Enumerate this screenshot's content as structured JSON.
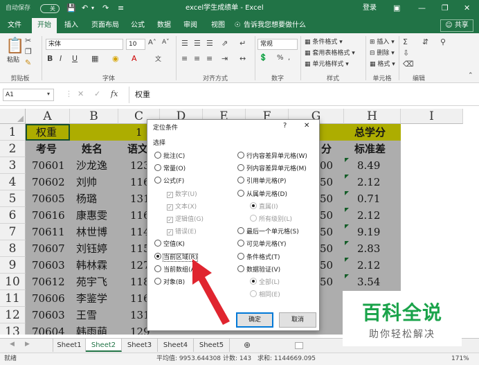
{
  "title_bar": {
    "autosave": "自动保存",
    "autosave_state": "关",
    "title": "excel学生成绩单 - Excel",
    "login": "登录"
  },
  "tabs": [
    "文件",
    "开始",
    "插入",
    "页面布局",
    "公式",
    "数据",
    "审阅",
    "视图",
    "告诉我您想要做什么",
    "共享"
  ],
  "ribbon": {
    "paste": "粘贴",
    "clipboard": "剪贴板",
    "font_name": "宋体",
    "font_size": "10",
    "font_group": "字体",
    "align_group": "对齐方式",
    "number_format": "常规",
    "number_group": "数字",
    "cond_format": "条件格式",
    "table_format": "套用表格格式",
    "cell_style": "单元格样式",
    "style_group": "样式",
    "insert": "插入",
    "delete": "删除",
    "format": "格式",
    "cells_group": "单元格",
    "edit_group": "编辑"
  },
  "formula_bar": {
    "name_box": "A1",
    "fx": "fx",
    "value": "权重"
  },
  "columns": [
    "A",
    "B",
    "C",
    "D",
    "E",
    "F",
    "G",
    "H",
    "I"
  ],
  "rows": [
    "1",
    "2",
    "3",
    "4",
    "5",
    "6",
    "7",
    "8",
    "9",
    "10",
    "11",
    "12",
    "13"
  ],
  "cells": {
    "a1": "权重",
    "c1": "1",
    "h1": "总学分",
    "a2": "考号",
    "b2": "姓名",
    "c2": "语文",
    "g2": "分",
    "h2": "标准差",
    "data": [
      {
        "id": "70601",
        "name": "沙龙逸",
        "c": "123",
        "g": "00",
        "h": "8.49"
      },
      {
        "id": "70602",
        "name": "刘帅",
        "c": "116",
        "g": "50",
        "h": "2.12"
      },
      {
        "id": "70605",
        "name": "杨璐",
        "c": "131",
        "g": "50",
        "h": "0.71"
      },
      {
        "id": "70616",
        "name": "康惠雯",
        "c": "116",
        "g": "50",
        "h": "2.12"
      },
      {
        "id": "70611",
        "name": "林世博",
        "c": "114",
        "g": "50",
        "h": "9.19"
      },
      {
        "id": "70607",
        "name": "刘钰婷",
        "c": "115",
        "g": "50",
        "h": "2.83"
      },
      {
        "id": "70603",
        "name": "韩林霖",
        "c": "127",
        "g": "50",
        "h": "2.12"
      },
      {
        "id": "70612",
        "name": "苑宇飞",
        "c": "118",
        "g": "50",
        "h": "3.54"
      },
      {
        "id": "70606",
        "name": "李鉴学",
        "c": "116",
        "g": "",
        "h": ""
      },
      {
        "id": "70603",
        "name": "王雪",
        "c": "131",
        "g": "",
        "h": ""
      },
      {
        "id": "70604",
        "name": "韩雨萌",
        "c": "129",
        "g": "",
        "h": ""
      }
    ]
  },
  "dialog": {
    "title": "定位条件",
    "help": "?",
    "close": "✕",
    "section": "选择",
    "left": [
      {
        "label": "批注(C)",
        "kind": "radio",
        "on": false,
        "disabled": false
      },
      {
        "label": "常量(O)",
        "kind": "radio",
        "on": false,
        "disabled": false
      },
      {
        "label": "公式(F)",
        "kind": "radio",
        "on": false,
        "disabled": false
      },
      {
        "label": "数字(U)",
        "kind": "check",
        "on": true,
        "disabled": true
      },
      {
        "label": "文本(X)",
        "kind": "check",
        "on": true,
        "disabled": true
      },
      {
        "label": "逻辑值(G)",
        "kind": "check",
        "on": true,
        "disabled": true
      },
      {
        "label": "错误(E)",
        "kind": "check",
        "on": true,
        "disabled": true
      },
      {
        "label": "空值(K)",
        "kind": "radio",
        "on": false,
        "disabled": false
      },
      {
        "label": "当前区域(R)",
        "kind": "radio",
        "on": true,
        "disabled": false
      },
      {
        "label": "当前数组(A)",
        "kind": "radio",
        "on": false,
        "disabled": false
      },
      {
        "label": "对象(B)",
        "kind": "radio",
        "on": false,
        "disabled": false
      }
    ],
    "right": [
      {
        "label": "行内容差异单元格(W)",
        "kind": "radio",
        "on": false,
        "disabled": false
      },
      {
        "label": "列内容差异单元格(M)",
        "kind": "radio",
        "on": false,
        "disabled": false
      },
      {
        "label": "引用单元格(P)",
        "kind": "radio",
        "on": false,
        "disabled": false
      },
      {
        "label": "从属单元格(D)",
        "kind": "radio",
        "on": false,
        "disabled": false
      },
      {
        "label": "直属(I)",
        "kind": "radio",
        "on": true,
        "disabled": true
      },
      {
        "label": "所有级别(L)",
        "kind": "radio",
        "on": false,
        "disabled": true
      },
      {
        "label": "最后一个单元格(S)",
        "kind": "radio",
        "on": false,
        "disabled": false
      },
      {
        "label": "可见单元格(Y)",
        "kind": "radio",
        "on": false,
        "disabled": false
      },
      {
        "label": "条件格式(T)",
        "kind": "radio",
        "on": false,
        "disabled": false
      },
      {
        "label": "数据验证(V)",
        "kind": "radio",
        "on": false,
        "disabled": false
      },
      {
        "label": "全部(L)",
        "kind": "radio",
        "on": true,
        "disabled": true
      },
      {
        "label": "相同(E)",
        "kind": "radio",
        "on": false,
        "disabled": true
      }
    ],
    "ok": "确定",
    "cancel": "取消"
  },
  "sheets": [
    "Sheet1",
    "Sheet2",
    "Sheet3",
    "Sheet4",
    "Sheet5"
  ],
  "active_sheet": "Sheet2",
  "status": {
    "ready": "就绪",
    "avg": "平均值: 9953.644308",
    "count": "计数: 143",
    "sum": "求和: 1144669.095",
    "zoom": "171%"
  },
  "watermark": {
    "brand": "百科全说",
    "slogan": "助你轻松解决"
  },
  "colors": {
    "excel_green": "#217346",
    "highlight_yellow": "#ffff00",
    "arrow_red": "#e0252f"
  }
}
